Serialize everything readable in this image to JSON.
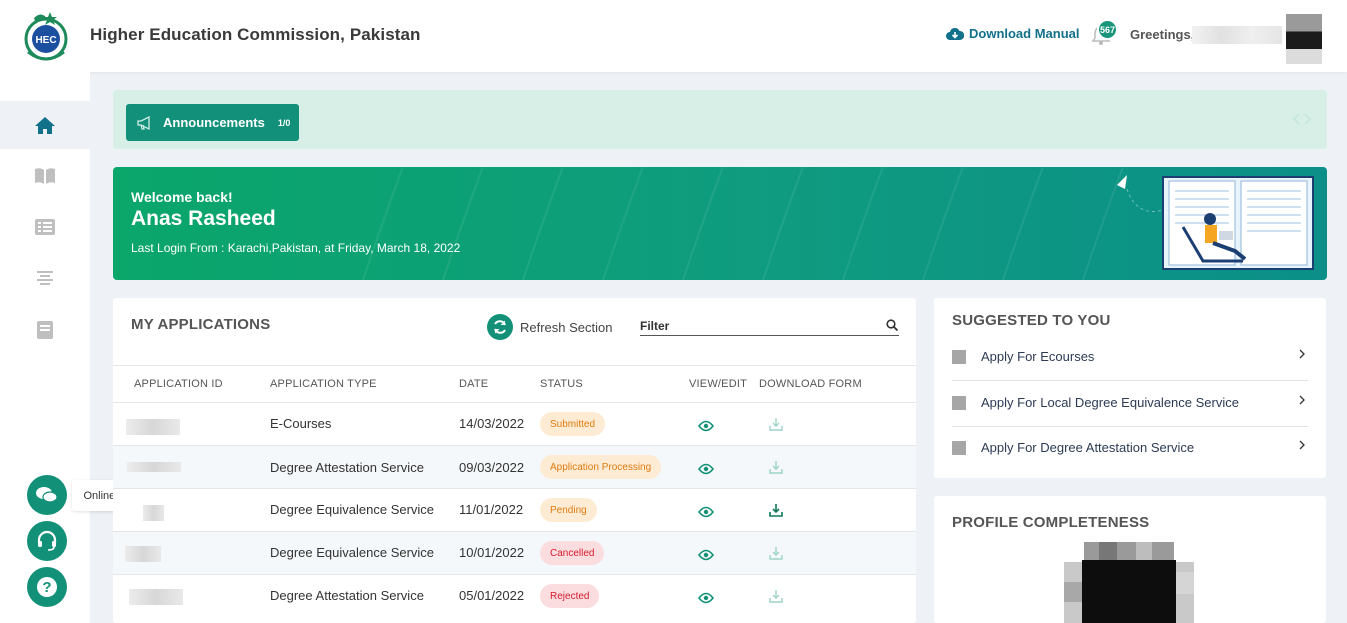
{
  "header": {
    "title": "Higher Education Commission, Pakistan",
    "download_manual": "Download Manual",
    "notification_count": "567",
    "greeting": "Greetings,"
  },
  "sidebar": {
    "items": [
      {
        "name": "home-icon",
        "active": true
      },
      {
        "name": "book-icon",
        "active": false
      },
      {
        "name": "list-icon",
        "active": false
      },
      {
        "name": "align-center-icon",
        "active": false
      },
      {
        "name": "notebook-icon",
        "active": false
      }
    ]
  },
  "floating": {
    "chat_tooltip": "Online Chat"
  },
  "announcements": {
    "label": "Announcements",
    "count": "1/0"
  },
  "banner": {
    "welcome": "Welcome back!",
    "user_name": "Anas Rasheed",
    "last_login": "Last Login From : Karachi,Pakistan, at Friday, March 18, 2022"
  },
  "applications": {
    "title": "MY APPLICATIONS",
    "refresh_label": "Refresh Section",
    "filter_placeholder": "Filter",
    "columns": [
      "APPLICATION ID",
      "APPLICATION TYPE",
      "DATE",
      "STATUS",
      "VIEW/EDIT",
      "DOWNLOAD FORM"
    ],
    "rows": [
      {
        "type": "E-Courses",
        "date": "14/03/2022",
        "status": "Submitted",
        "download_enabled": false
      },
      {
        "type": "Degree Attestation Service",
        "date": "09/03/2022",
        "status": "Application Processing",
        "download_enabled": false
      },
      {
        "type": "Degree Equivalence Service",
        "date": "11/01/2022",
        "status": "Pending",
        "download_enabled": true
      },
      {
        "type": "Degree Equivalence Service",
        "date": "10/01/2022",
        "status": "Cancelled",
        "download_enabled": false
      },
      {
        "type": "Degree Attestation Service",
        "date": "05/01/2022",
        "status": "Rejected",
        "download_enabled": false
      }
    ]
  },
  "suggested": {
    "title": "SUGGESTED TO YOU",
    "items": [
      "Apply For Ecourses",
      "Apply For Local Degree Equivalence Service",
      "Apply For Degree Attestation Service"
    ]
  },
  "profile": {
    "title": "PROFILE COMPLETENESS"
  },
  "colors": {
    "brand": "#139178",
    "accent": "#11708a",
    "pending": "#e07b0e",
    "danger": "#d61b2c"
  }
}
